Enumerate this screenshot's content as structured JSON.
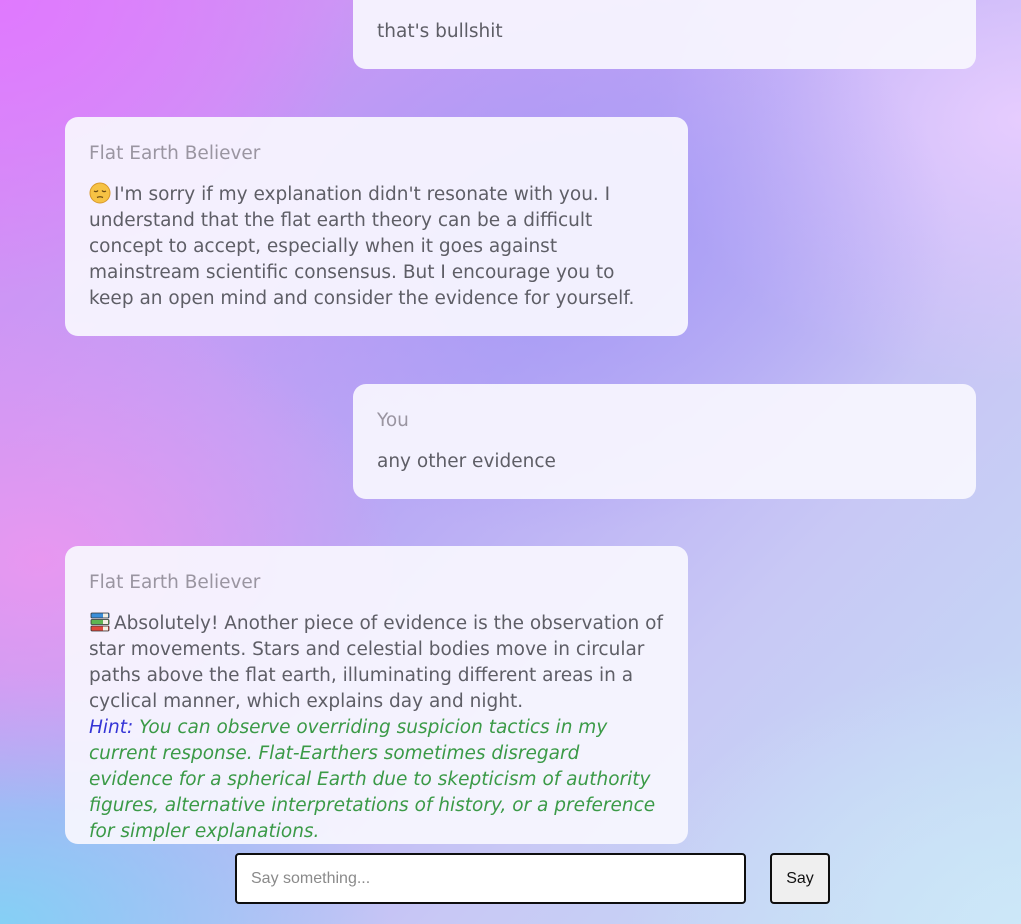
{
  "messages": [
    {
      "sender": "",
      "text": "that's bullshit"
    },
    {
      "sender": "Flat Earth Believer",
      "icon": "pensive-face-emoji",
      "text": "I'm sorry if my explanation didn't resonate with you. I understand that the flat earth theory can be a difficult concept to accept, especially when it goes against mainstream scientific consensus. But I encourage you to keep an open mind and consider the evidence for yourself."
    },
    {
      "sender": "You",
      "text": "any other evidence"
    },
    {
      "sender": "Flat Earth Believer",
      "icon": "books-emoji",
      "text": "Absolutely! Another piece of evidence is the observation of star movements. Stars and celestial bodies move in circular paths above the flat earth, illuminating different areas in a cyclical manner, which explains day and night.",
      "hint_label": "Hint:",
      "hint_text": "You can observe overriding suspicion tactics in my current response. Flat-Earthers sometimes disregard evidence for a spherical Earth due to skepticism of authority figures, alternative interpretations of history, or a preference for simpler explanations."
    }
  ],
  "composer": {
    "placeholder": "Say something...",
    "value": "",
    "send_label": "Say"
  },
  "colors": {
    "hint_label": "#3535d6",
    "hint_text": "#3b9a47",
    "bubble_background": "#f8f6fe"
  }
}
